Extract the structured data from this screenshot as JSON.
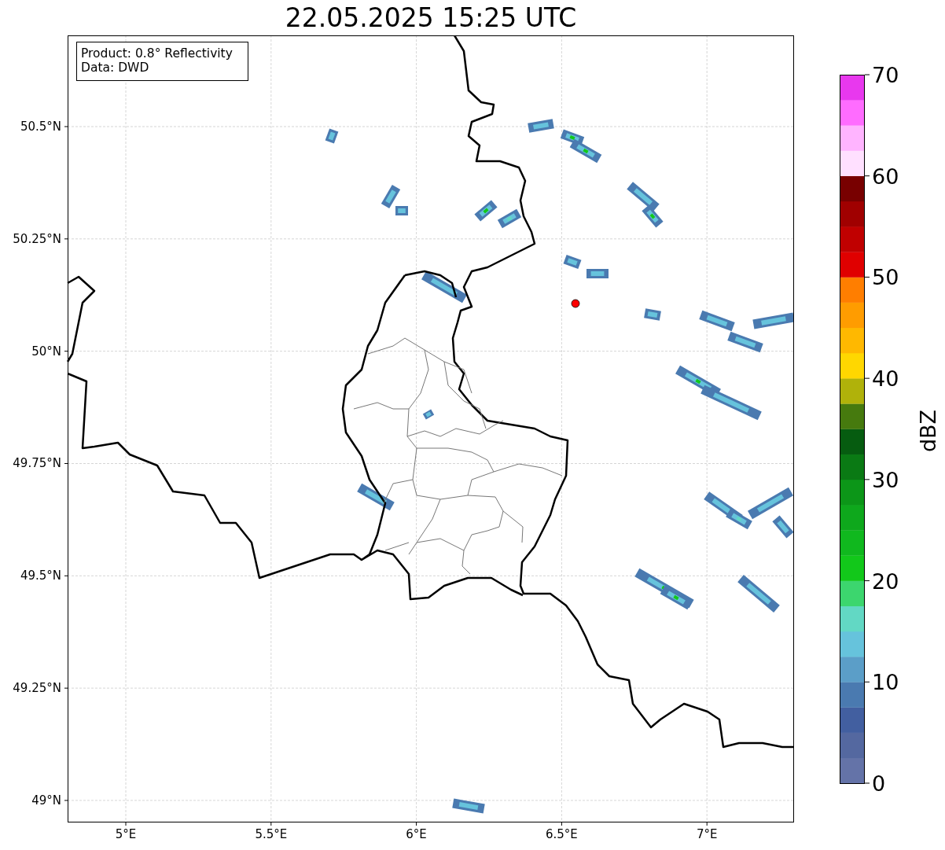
{
  "title": "22.05.2025 15:25 UTC",
  "info_box": [
    "Product: 0.8° Reflectivity",
    "Data: DWD"
  ],
  "map": {
    "y_ticks": [
      "50.5°N",
      "50.25°N",
      "50°N",
      "49.75°N",
      "49.5°N",
      "49.25°N",
      "49°N"
    ],
    "x_ticks": [
      "5°E",
      "5.5°E",
      "6°E",
      "6.5°E",
      "7°E"
    ]
  },
  "colorbar": {
    "label": "dBZ",
    "ticks": [
      "70",
      "60",
      "50",
      "40",
      "30",
      "20",
      "10",
      "0"
    ],
    "bins": [
      {
        "color": "#6473a8"
      },
      {
        "color": "#5468a0"
      },
      {
        "color": "#425fa0"
      },
      {
        "color": "#4a7ab0"
      },
      {
        "color": "#5b9ec8"
      },
      {
        "color": "#66c3dc"
      },
      {
        "color": "#62d8c4"
      },
      {
        "color": "#3cd66e"
      },
      {
        "color": "#12c81a"
      },
      {
        "color": "#10b81e"
      },
      {
        "color": "#0ea81c"
      },
      {
        "color": "#0c9618"
      },
      {
        "color": "#0a7a14"
      },
      {
        "color": "#065c10"
      },
      {
        "color": "#467a0e"
      },
      {
        "color": "#b0b20a"
      },
      {
        "color": "#ffd700"
      },
      {
        "color": "#ffb800"
      },
      {
        "color": "#ff9c00"
      },
      {
        "color": "#ff7e00"
      },
      {
        "color": "#e00000"
      },
      {
        "color": "#c00000"
      },
      {
        "color": "#a00000"
      },
      {
        "color": "#780000"
      },
      {
        "color": "#ffe0ff"
      },
      {
        "color": "#ffb4ff"
      },
      {
        "color": "#ff6cff"
      },
      {
        "color": "#e838ee"
      }
    ]
  }
}
